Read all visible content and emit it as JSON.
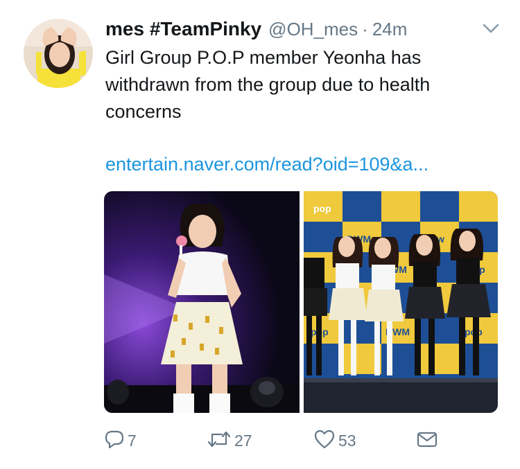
{
  "tweet": {
    "author": {
      "display_name": "mes #TeamPinky",
      "handle": "@OH_mes",
      "separator": "·",
      "time": "24m"
    },
    "text_lines": [
      "Girl Group P.O.P member Yeonha has",
      "withdrawn from the group due to health",
      "concerns"
    ],
    "link": "entertain.naver.com/read?oid=109&a...",
    "media": [
      {
        "icon": "photo-performer-on-stage"
      },
      {
        "icon": "photo-group-at-backdrop"
      }
    ],
    "actions": {
      "reply_count": "7",
      "retweet_count": "27",
      "like_count": "53"
    },
    "backdrop_text": [
      "pop",
      "DWM",
      "rbw",
      "pop",
      "WM",
      "pop",
      "DWM",
      "pop"
    ]
  },
  "colors": {
    "link": "#1b95e0",
    "secondary": "#657786",
    "text": "#14171a"
  }
}
